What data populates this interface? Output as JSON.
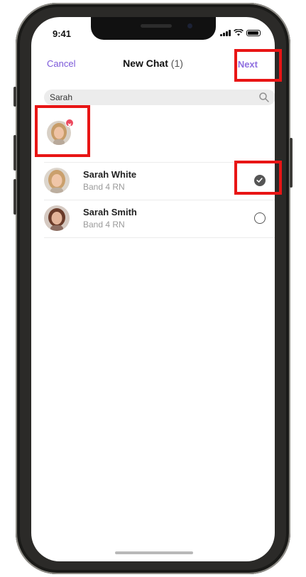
{
  "status_bar": {
    "time": "9:41"
  },
  "header": {
    "cancel_label": "Cancel",
    "title": "New Chat",
    "selected_count": "(1)",
    "next_label": "Next"
  },
  "search": {
    "value": "Sarah",
    "placeholder": ""
  },
  "contacts": [
    {
      "name": "Sarah White",
      "role": "Band 4 RN",
      "selected": true
    },
    {
      "name": "Sarah Smith",
      "role": "Band 4 RN",
      "selected": false
    }
  ],
  "colors": {
    "accent": "#7b58d9",
    "highlight": "#e81515",
    "remove_badge": "#ec4a5f"
  }
}
